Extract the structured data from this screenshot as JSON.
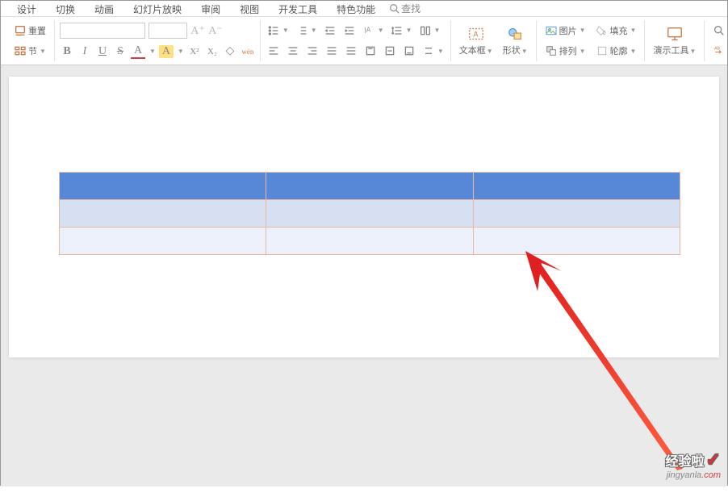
{
  "tabs": {
    "design": "设计",
    "transition": "切换",
    "animation": "动画",
    "slideshow": "幻灯片放映",
    "review": "审阅",
    "view": "视图",
    "devtools": "开发工具",
    "features": "特色功能"
  },
  "search": {
    "label": "查找"
  },
  "toolbar": {
    "reset": "重置",
    "section": "节",
    "font_name": "",
    "font_size": "",
    "inc_font": "A⁺",
    "dec_font": "A⁻",
    "bold": "B",
    "italic": "I",
    "underline": "U",
    "strike": "S",
    "font_color": "A",
    "highlight": "A",
    "sup": "X²",
    "sub": "X₂",
    "clear_fmt": "◇",
    "pinyin": "wén",
    "textbox": "文本框",
    "shapes": "形状",
    "picture": "图片",
    "arrange": "排列",
    "fill": "填充",
    "outline": "轮廓",
    "present": "演示工具",
    "replace": "替"
  },
  "right_search": "查",
  "watermark": {
    "brand": "经验啦",
    "url_prefix": "jingyanla",
    "url_suffix": ".com"
  }
}
